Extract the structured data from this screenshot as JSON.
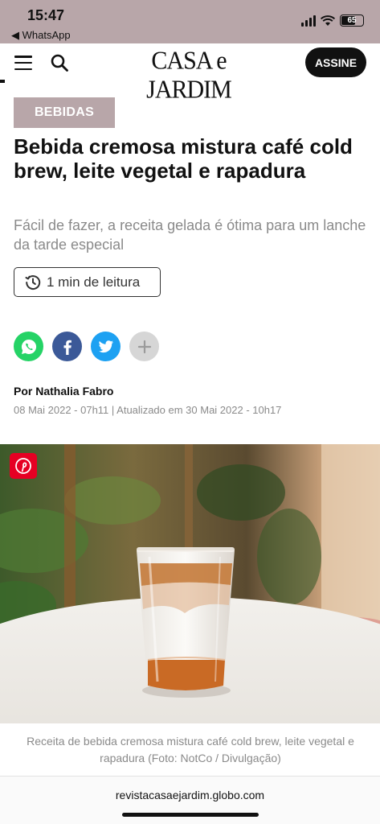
{
  "status_bar": {
    "time": "15:47",
    "back_app": "◀ WhatsApp",
    "battery": "65",
    "background_color": "#b8a6a9"
  },
  "header": {
    "logo": "CASA e JARDIM",
    "subscribe_label": "ASSINE",
    "menu_icon": "hamburger-menu-icon",
    "search_icon": "search-icon"
  },
  "article": {
    "category": "BEBIDAS",
    "title": "Bebida cremosa mistura café cold brew, leite vegetal e rapadura",
    "subtitle": "Fácil de fazer, a receita gelada é ótima para um lanche da tarde especial",
    "read_time": "1 min de leitura",
    "share": [
      "whatsapp-icon",
      "facebook-icon",
      "twitter-icon",
      "plus-icon"
    ],
    "author": "Por Nathalia Fabro",
    "dates": "08 Mai 2022 - 07h11 | Atualizado em 30 Mai 2022 - 10h17",
    "caption": "Receita de bebida cremosa mistura café cold brew, leite vegetal e rapadura (Foto: NotCo / Divulgação)"
  },
  "browser": {
    "url": "revistacasaejardim.globo.com"
  },
  "colors": {
    "accent": "#b8a6a9",
    "whatsapp": "#25d366",
    "facebook": "#3b5998",
    "twitter": "#1da1f2",
    "pinterest": "#e60023"
  }
}
